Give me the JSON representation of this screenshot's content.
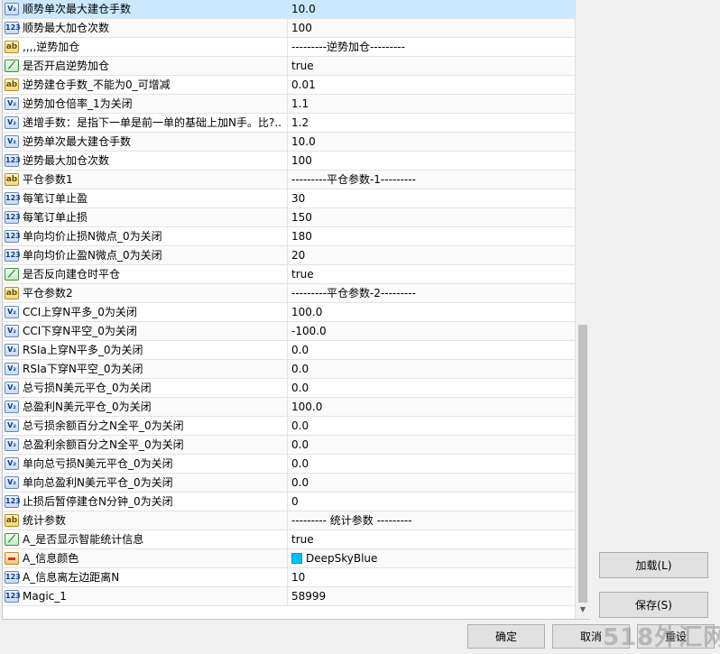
{
  "colors": {
    "selected_row": "#cce8ff",
    "swatch_deepskyblue": "#00bfff"
  },
  "rows": [
    {
      "icon": "double-icon",
      "label": "顺势单次最大建仓手数",
      "value": "10.0"
    },
    {
      "icon": "int-icon",
      "label": "顺势最大加仓次数",
      "value": "100"
    },
    {
      "icon": "string-icon",
      "label": ",,,,逆势加仓",
      "value": "---------逆势加仓---------"
    },
    {
      "icon": "bool-icon",
      "label": "是否开启逆势加仓",
      "value": "true"
    },
    {
      "icon": "string-icon",
      "label": "逆势建仓手数_不能为0_可增减",
      "value": "0.01"
    },
    {
      "icon": "double-icon",
      "label": "逆势加仓倍率_1为关闭",
      "value": "1.1"
    },
    {
      "icon": "double-icon",
      "label": "递增手数：是指下一单是前一单的基础上加N手。比?..",
      "value": "1.2"
    },
    {
      "icon": "double-icon",
      "label": "逆势单次最大建仓手数",
      "value": "10.0"
    },
    {
      "icon": "int-icon",
      "label": "逆势最大加仓次数",
      "value": "100"
    },
    {
      "icon": "string-icon",
      "label": "平仓参数1",
      "value": "---------平仓参数-1---------"
    },
    {
      "icon": "int-icon",
      "label": "每笔订单止盈",
      "value": "30"
    },
    {
      "icon": "int-icon",
      "label": "每笔订单止损",
      "value": "150"
    },
    {
      "icon": "int-icon",
      "label": "单向均价止损N微点_0为关闭",
      "value": "180"
    },
    {
      "icon": "int-icon",
      "label": "单向均价止盈N微点_0为关闭",
      "value": "20"
    },
    {
      "icon": "bool-icon",
      "label": "是否反向建仓时平仓",
      "value": "true"
    },
    {
      "icon": "string-icon",
      "label": "平仓参数2",
      "value": "---------平仓参数-2---------"
    },
    {
      "icon": "double-icon",
      "label": "CCI上穿N平多_0为关闭",
      "value": "100.0"
    },
    {
      "icon": "double-icon",
      "label": "CCI下穿N平空_0为关闭",
      "value": "-100.0"
    },
    {
      "icon": "double-icon",
      "label": "RSIa上穿N平多_0为关闭",
      "value": "0.0"
    },
    {
      "icon": "double-icon",
      "label": "RSIa下穿N平空_0为关闭",
      "value": "0.0"
    },
    {
      "icon": "double-icon",
      "label": "总亏损N美元平仓_0为关闭",
      "value": "0.0"
    },
    {
      "icon": "double-icon",
      "label": "总盈利N美元平仓_0为关闭",
      "value": "100.0"
    },
    {
      "icon": "double-icon",
      "label": "总亏损余额百分之N全平_0为关闭",
      "value": "0.0"
    },
    {
      "icon": "double-icon",
      "label": "总盈利余额百分之N全平_0为关闭",
      "value": "0.0"
    },
    {
      "icon": "double-icon",
      "label": "单向总亏损N美元平仓_0为关闭",
      "value": "0.0"
    },
    {
      "icon": "double-icon",
      "label": "单向总盈利N美元平仓_0为关闭",
      "value": "0.0"
    },
    {
      "icon": "int-icon",
      "label": "止损后暂停建仓N分钟_0为关闭",
      "value": "0"
    },
    {
      "icon": "string-icon",
      "label": "统计参数",
      "value": "--------- 统计参数 ---------"
    },
    {
      "icon": "bool-icon",
      "label": "A_是否显示智能统计信息",
      "value": "true"
    },
    {
      "icon": "color-icon",
      "label": "A_信息颜色",
      "value": "DeepSkyBlue",
      "swatch": true
    },
    {
      "icon": "int-icon",
      "label": "A_信息离左边距离N",
      "value": "10"
    },
    {
      "icon": "int-icon",
      "label": "Magic_1",
      "value": "58999"
    }
  ],
  "buttons": {
    "load": "加载(L)",
    "save": "保存(S)",
    "ok": "确定",
    "cancel": "取消",
    "reset": "重设"
  },
  "watermark": "518外汇网"
}
